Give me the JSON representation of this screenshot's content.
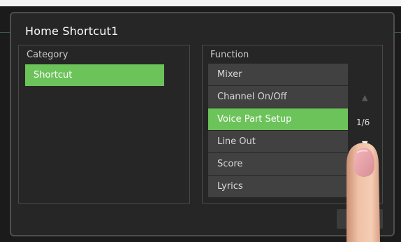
{
  "dialog": {
    "title": "Home Shortcut1"
  },
  "category": {
    "label": "Category",
    "items": [
      {
        "label": "Shortcut",
        "selected": true
      }
    ]
  },
  "function": {
    "label": "Function",
    "items": [
      {
        "label": "Mixer",
        "selected": false
      },
      {
        "label": "Channel On/Off",
        "selected": false
      },
      {
        "label": "Voice Part Setup",
        "selected": true
      },
      {
        "label": "Line Out",
        "selected": false
      },
      {
        "label": "Score",
        "selected": false
      },
      {
        "label": "Lyrics",
        "selected": false
      }
    ],
    "page_indicator": "1/6",
    "scroll_up_icon": "triangle-up-icon",
    "scroll_down_icon": "triangle-down-icon"
  },
  "colors": {
    "accent_green": "#6cc35a",
    "item_bg": "#414141",
    "dialog_bg": "#262626"
  }
}
